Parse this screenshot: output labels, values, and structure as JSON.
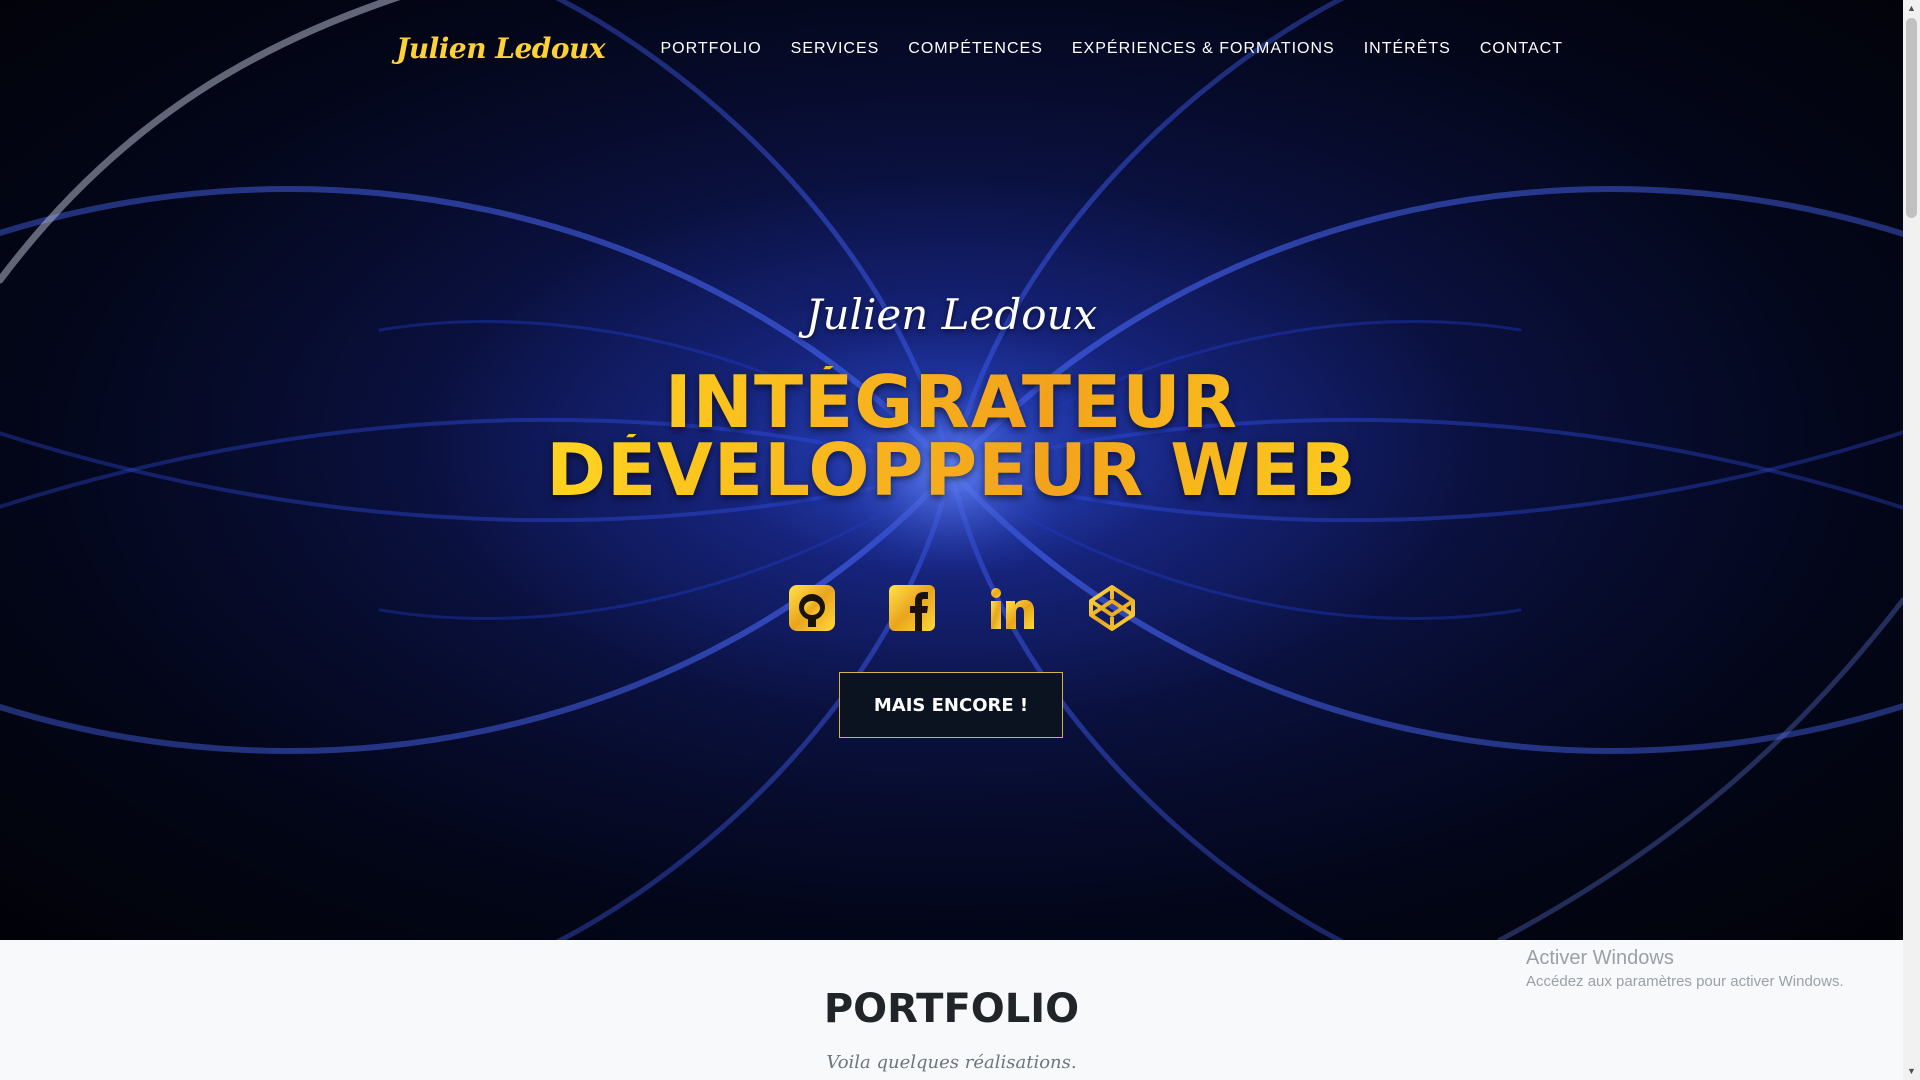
{
  "nav": {
    "brand": "Julien Ledoux",
    "items": [
      {
        "label": "PORTFOLIO"
      },
      {
        "label": "SERVICES"
      },
      {
        "label": "COMPÉTENCES"
      },
      {
        "label": "EXPÉRIENCES & FORMATIONS"
      },
      {
        "label": "INTÉRÊTS"
      },
      {
        "label": "CONTACT"
      }
    ]
  },
  "hero": {
    "name": "Julien Ledoux",
    "headline_line1": "INTÉGRATEUR",
    "headline_line2": "DÉVELOPPEUR WEB",
    "socials": [
      {
        "icon": "github-icon"
      },
      {
        "icon": "facebook-icon"
      },
      {
        "icon": "linkedin-icon"
      },
      {
        "icon": "codepen-icon"
      }
    ],
    "cta_label": "MAIS ENCORE !"
  },
  "portfolio": {
    "title": "PORTFOLIO",
    "subtitle": "Voila quelques réalisations."
  },
  "watermark": {
    "title": "Activer Windows",
    "subtitle": "Accédez aux paramètres pour activer Windows."
  },
  "colors": {
    "accent": "#fed136",
    "hero_blue": "#16237a",
    "cta_bg": "#0b1220",
    "section_bg": "#f8f9fa"
  }
}
